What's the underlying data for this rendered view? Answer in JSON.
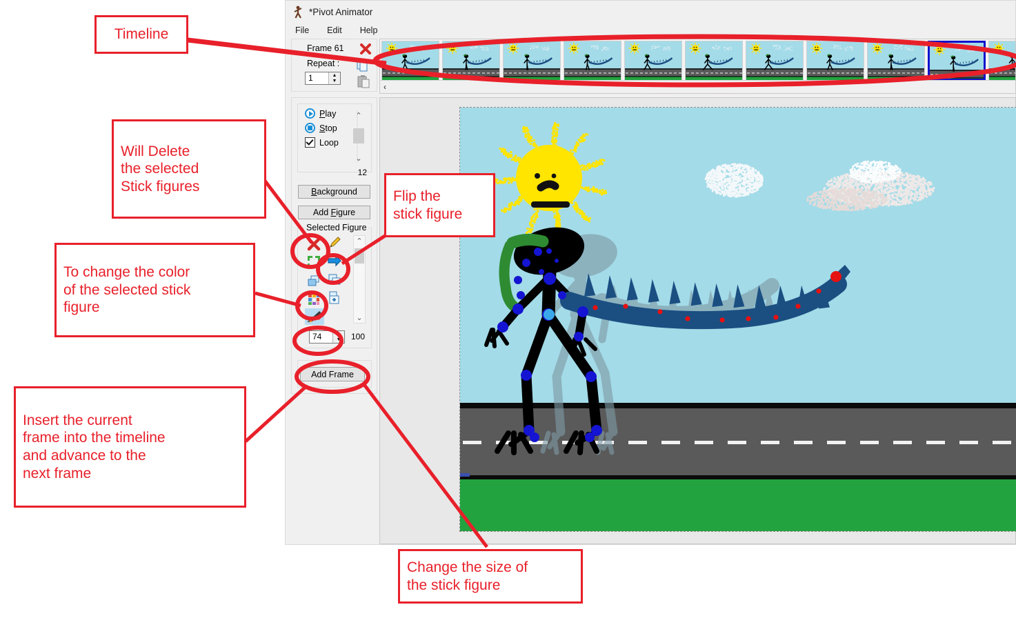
{
  "window": {
    "title": "*Pivot Animator",
    "app_icon": "stick-figure-icon",
    "menu": [
      "File",
      "Edit",
      "Help"
    ]
  },
  "frame_panel": {
    "frame_label": "Frame 61",
    "repeat_label": "Repeat :",
    "repeat_value": "1",
    "delete_frame_icon": "red-x-icon",
    "copy_icon": "copy-icon",
    "paste_icon": "paste-icon"
  },
  "playback": {
    "play_label": "Play",
    "stop_label": "Stop",
    "loop_label": "Loop",
    "loop_checked": true,
    "fps_value": "12"
  },
  "buttons": {
    "background": "Background",
    "add_figure": "Add Figure",
    "add_frame": "Add Frame"
  },
  "selected_figure": {
    "group_title": "Selected Figure",
    "size_value": "74",
    "size_max": "100",
    "tools": [
      {
        "name": "delete-figure-icon",
        "label": "Delete figure"
      },
      {
        "name": "edit-figure-icon",
        "label": "Edit figure"
      },
      {
        "name": "resize-figure-icon",
        "label": "Resize figure"
      },
      {
        "name": "flip-figure-icon",
        "label": "Flip figure"
      },
      {
        "name": "copy-figure-icon",
        "label": "Copy figure"
      },
      {
        "name": "duplicate-figure-icon",
        "label": "Duplicate figure"
      },
      {
        "name": "color-figure-icon",
        "label": "Change colour"
      },
      {
        "name": "add-to-library-icon",
        "label": "Add to library"
      },
      {
        "name": "pen-tool-icon",
        "label": "Pen tool"
      }
    ]
  },
  "timeline": {
    "frame_count": 11,
    "selected_index": 9,
    "scroll_left_arrow": "‹"
  },
  "canvas": {
    "sky_color": "#a3dbe8",
    "road_color": "#5a5a5a",
    "grass_color": "#22a33f",
    "sun_color": "#ffe500",
    "figure_color": "#000000",
    "tail_color": "#1b4f82",
    "joint_color": "#1414d2",
    "tail_joint_color": "#e61111",
    "onion_skin_color": "#7f99a5",
    "hat_color": "#2e8b32"
  },
  "annotations": [
    {
      "id": "timeline",
      "text": "Timeline"
    },
    {
      "id": "delete",
      "text": "Will Delete\nthe selected\nStick figures"
    },
    {
      "id": "flip",
      "text": "Flip the\nstick figure"
    },
    {
      "id": "color",
      "text": "To change the color\nof the selected stick\nfigure"
    },
    {
      "id": "addframe",
      "text": "Insert the current\nframe into the timeline\nand advance to the\nnext frame"
    },
    {
      "id": "size",
      "text": "Change the size of\nthe stick figure"
    }
  ]
}
